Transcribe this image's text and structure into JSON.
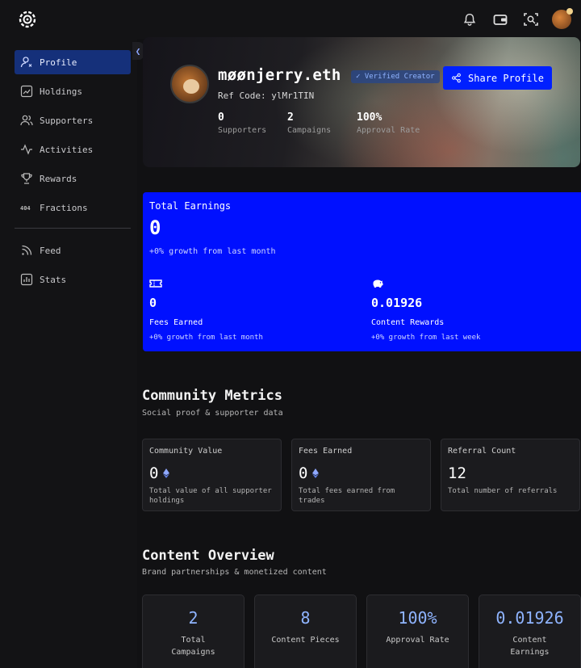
{
  "topbar": {
    "logo_icon": "gear-network-logo",
    "icons": [
      "bell-icon",
      "wallet-icon",
      "scan-icon",
      "avatar"
    ]
  },
  "sidebar": {
    "items": [
      {
        "label": "Profile",
        "icon": "user-icon",
        "active": true
      },
      {
        "label": "Holdings",
        "icon": "chart-icon"
      },
      {
        "label": "Supporters",
        "icon": "users-icon"
      },
      {
        "label": "Activities",
        "icon": "activity-icon"
      },
      {
        "label": "Rewards",
        "icon": "trophy-icon"
      },
      {
        "label": "Fractions",
        "icon": "404-icon"
      }
    ],
    "items2": [
      {
        "label": "Feed",
        "icon": "rss-icon"
      },
      {
        "label": "Stats",
        "icon": "stats-icon"
      }
    ]
  },
  "profile": {
    "name": "møønjerry.eth",
    "badge": "✓ Verified Creator",
    "ref_code": "Ref Code: ylMr1TIN",
    "stats": [
      {
        "value": "0",
        "label": "Supporters"
      },
      {
        "value": "2",
        "label": "Campaigns"
      },
      {
        "value": "100%",
        "label": "Approval Rate"
      }
    ],
    "share_label": "Share Profile"
  },
  "earnings": {
    "title": "Total Earnings",
    "value": "0",
    "growth": "+0% growth from last month",
    "fees": {
      "value": "0",
      "label": "Fees Earned",
      "growth": "+0% growth from last month"
    },
    "rewards": {
      "value": "0.01926",
      "label": "Content Rewards",
      "growth": "+0% growth from last week"
    }
  },
  "community": {
    "title": "Community Metrics",
    "subtitle": "Social proof & supporter data",
    "cards": [
      {
        "label": "Community Value",
        "value": "0",
        "eth": true,
        "desc": "Total value of all supporter holdings"
      },
      {
        "label": "Fees Earned",
        "value": "0",
        "eth": true,
        "desc": "Total fees earned from trades"
      },
      {
        "label": "Referral Count",
        "value": "12",
        "eth": false,
        "desc": "Total number of referrals"
      }
    ]
  },
  "content": {
    "title": "Content Overview",
    "subtitle": "Brand partnerships & monetized content",
    "cards": [
      {
        "value": "2",
        "label": "Total Campaigns"
      },
      {
        "value": "8",
        "label": "Content Pieces"
      },
      {
        "value": "100%",
        "label": "Approval Rate"
      },
      {
        "value": "0.01926",
        "label": "Content Earnings"
      }
    ]
  },
  "colors": {
    "accent_blue": "#0010ff",
    "active_nav": "#15307a",
    "value_blue": "#8fb4ff"
  }
}
